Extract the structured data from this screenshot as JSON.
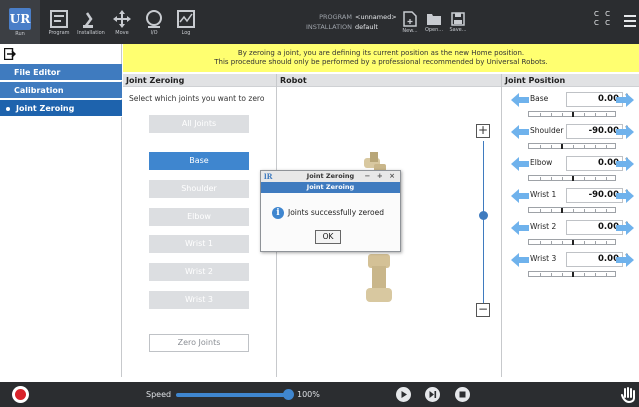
{
  "topbar": {
    "run_label": "Run",
    "program_label": "Program",
    "installation_label": "Installation",
    "move_label": "Move",
    "io_label": "I/O",
    "log_label": "Log",
    "program_key": "PROGRAM",
    "program_value": "<unnamed>",
    "installation_key": "INSTALLATION",
    "installation_value": "default",
    "new_label": "New...",
    "open_label": "Open...",
    "save_label": "Save...",
    "cc_top": "C C",
    "cc_bottom": "C C"
  },
  "nav": {
    "items": [
      {
        "label": "File Editor"
      },
      {
        "label": "Calibration"
      },
      {
        "label": "Joint Zeroing"
      }
    ]
  },
  "warning": {
    "line1": "By zeroing a joint, you are defining its current position as the new Home position.",
    "line2": "This procedure should only be performed by a professional recommended by Universal Robots."
  },
  "joint_zeroing": {
    "header": "Joint Zeroing",
    "instruction": "Select which joints you want to zero",
    "all_joints": "All Joints",
    "joints": [
      "Base",
      "Shoulder",
      "Elbow",
      "Wrist 1",
      "Wrist 2",
      "Wrist 3"
    ],
    "selected_joint": "Base",
    "zero_button": "Zero Joints"
  },
  "robot": {
    "header": "Robot",
    "zoom_in": "+",
    "zoom_out": "−"
  },
  "dialog": {
    "title": "Joint Zeroing",
    "header": "Joint Zeroing",
    "window_controls": "− + ×",
    "message": "Joints successfully zeroed",
    "ok": "OK"
  },
  "joint_position": {
    "header": "Joint Position",
    "unit": "°",
    "rows": [
      {
        "name": "Base",
        "value": "0.00",
        "fraction": 0.5
      },
      {
        "name": "Shoulder",
        "value": "-90.00",
        "fraction": 0.375
      },
      {
        "name": "Elbow",
        "value": "0.00",
        "fraction": 0.5
      },
      {
        "name": "Wrist 1",
        "value": "-90.00",
        "fraction": 0.375
      },
      {
        "name": "Wrist 2",
        "value": "0.00",
        "fraction": 0.5
      },
      {
        "name": "Wrist 3",
        "value": "0.00",
        "fraction": 0.5
      }
    ]
  },
  "bottombar": {
    "speed_label": "Speed",
    "speed_value": "100%",
    "speed_fraction": 1.0
  },
  "colors": {
    "accent": "#3f7bbf",
    "warning_bg": "#ffff70",
    "topbar_bg": "#2b2d30",
    "stop_red": "#d8232a"
  }
}
